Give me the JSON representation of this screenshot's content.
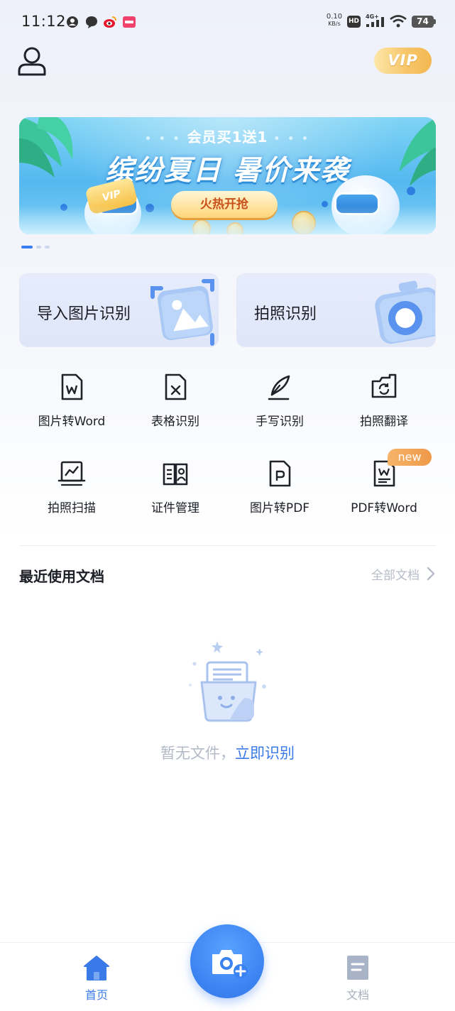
{
  "status_bar": {
    "time": "11:12",
    "net_speed_value": "0.10",
    "net_speed_unit": "KB/s",
    "hd_label": "HD",
    "network_label": "4G+",
    "battery_level": "74"
  },
  "header": {
    "vip_label": "VIP"
  },
  "banner": {
    "kicker": "会员买1送1",
    "kicker_decor_left": "• • •",
    "kicker_decor_right": "• • •",
    "headline": "缤纷夏日 暑价来袭",
    "vip_tag": "VIP",
    "cta": "火热开抢",
    "pager_total": 3,
    "pager_active": 1
  },
  "quick_actions": [
    {
      "label": "导入图片识别",
      "icon": "image-import-icon"
    },
    {
      "label": "拍照识别",
      "icon": "camera-icon"
    }
  ],
  "tools": [
    {
      "label": "图片转Word",
      "icon": "word-doc-icon"
    },
    {
      "label": "表格识别",
      "icon": "excel-doc-icon"
    },
    {
      "label": "手写识别",
      "icon": "quill-pen-icon"
    },
    {
      "label": "拍照翻译",
      "icon": "camera-translate-icon"
    },
    {
      "label": "拍照扫描",
      "icon": "scan-chart-icon"
    },
    {
      "label": "证件管理",
      "icon": "id-card-icon"
    },
    {
      "label": "图片转PDF",
      "icon": "pdf-doc-icon"
    },
    {
      "label": "PDF转Word",
      "icon": "pdf-to-word-icon",
      "badge": "new"
    }
  ],
  "recent": {
    "title": "最近使用文档",
    "all_docs": "全部文档"
  },
  "empty_state": {
    "text": "暂无文件，",
    "link": "立即识别"
  },
  "bottom_nav": {
    "home_label": "首页",
    "docs_label": "文档"
  },
  "colors": {
    "accent": "#3a7ae8",
    "vip_gold": "#f3b850",
    "badge_orange": "#ef9948"
  }
}
